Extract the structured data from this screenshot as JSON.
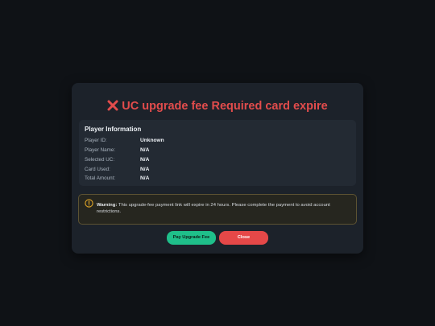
{
  "dialog": {
    "title": "UC upgrade fee Required card expire",
    "title_icon": "red-x-icon"
  },
  "player_info": {
    "heading": "Player Information",
    "rows": [
      {
        "label": "Player ID:",
        "value": "Unknown"
      },
      {
        "label": "Player Name:",
        "value": "N/A"
      },
      {
        "label": "Selected UC:",
        "value": "N/A"
      },
      {
        "label": "Card Used:",
        "value": "N/A"
      },
      {
        "label": "Total Amount:",
        "value": "N/A"
      }
    ]
  },
  "warning": {
    "icon": "warning-circle-icon",
    "label": "Warning:",
    "text": " This upgrade-fee payment link will expire in 24 hours. Please complete the payment to avoid account restrictions."
  },
  "buttons": {
    "pay_label": "Pay Upgrade Fee",
    "close_label": "Close"
  },
  "colors": {
    "accent_red": "#e24c4c",
    "pay_green": "#1fbf8a",
    "close_red": "#e54848",
    "warning_amber": "#e0a526"
  }
}
